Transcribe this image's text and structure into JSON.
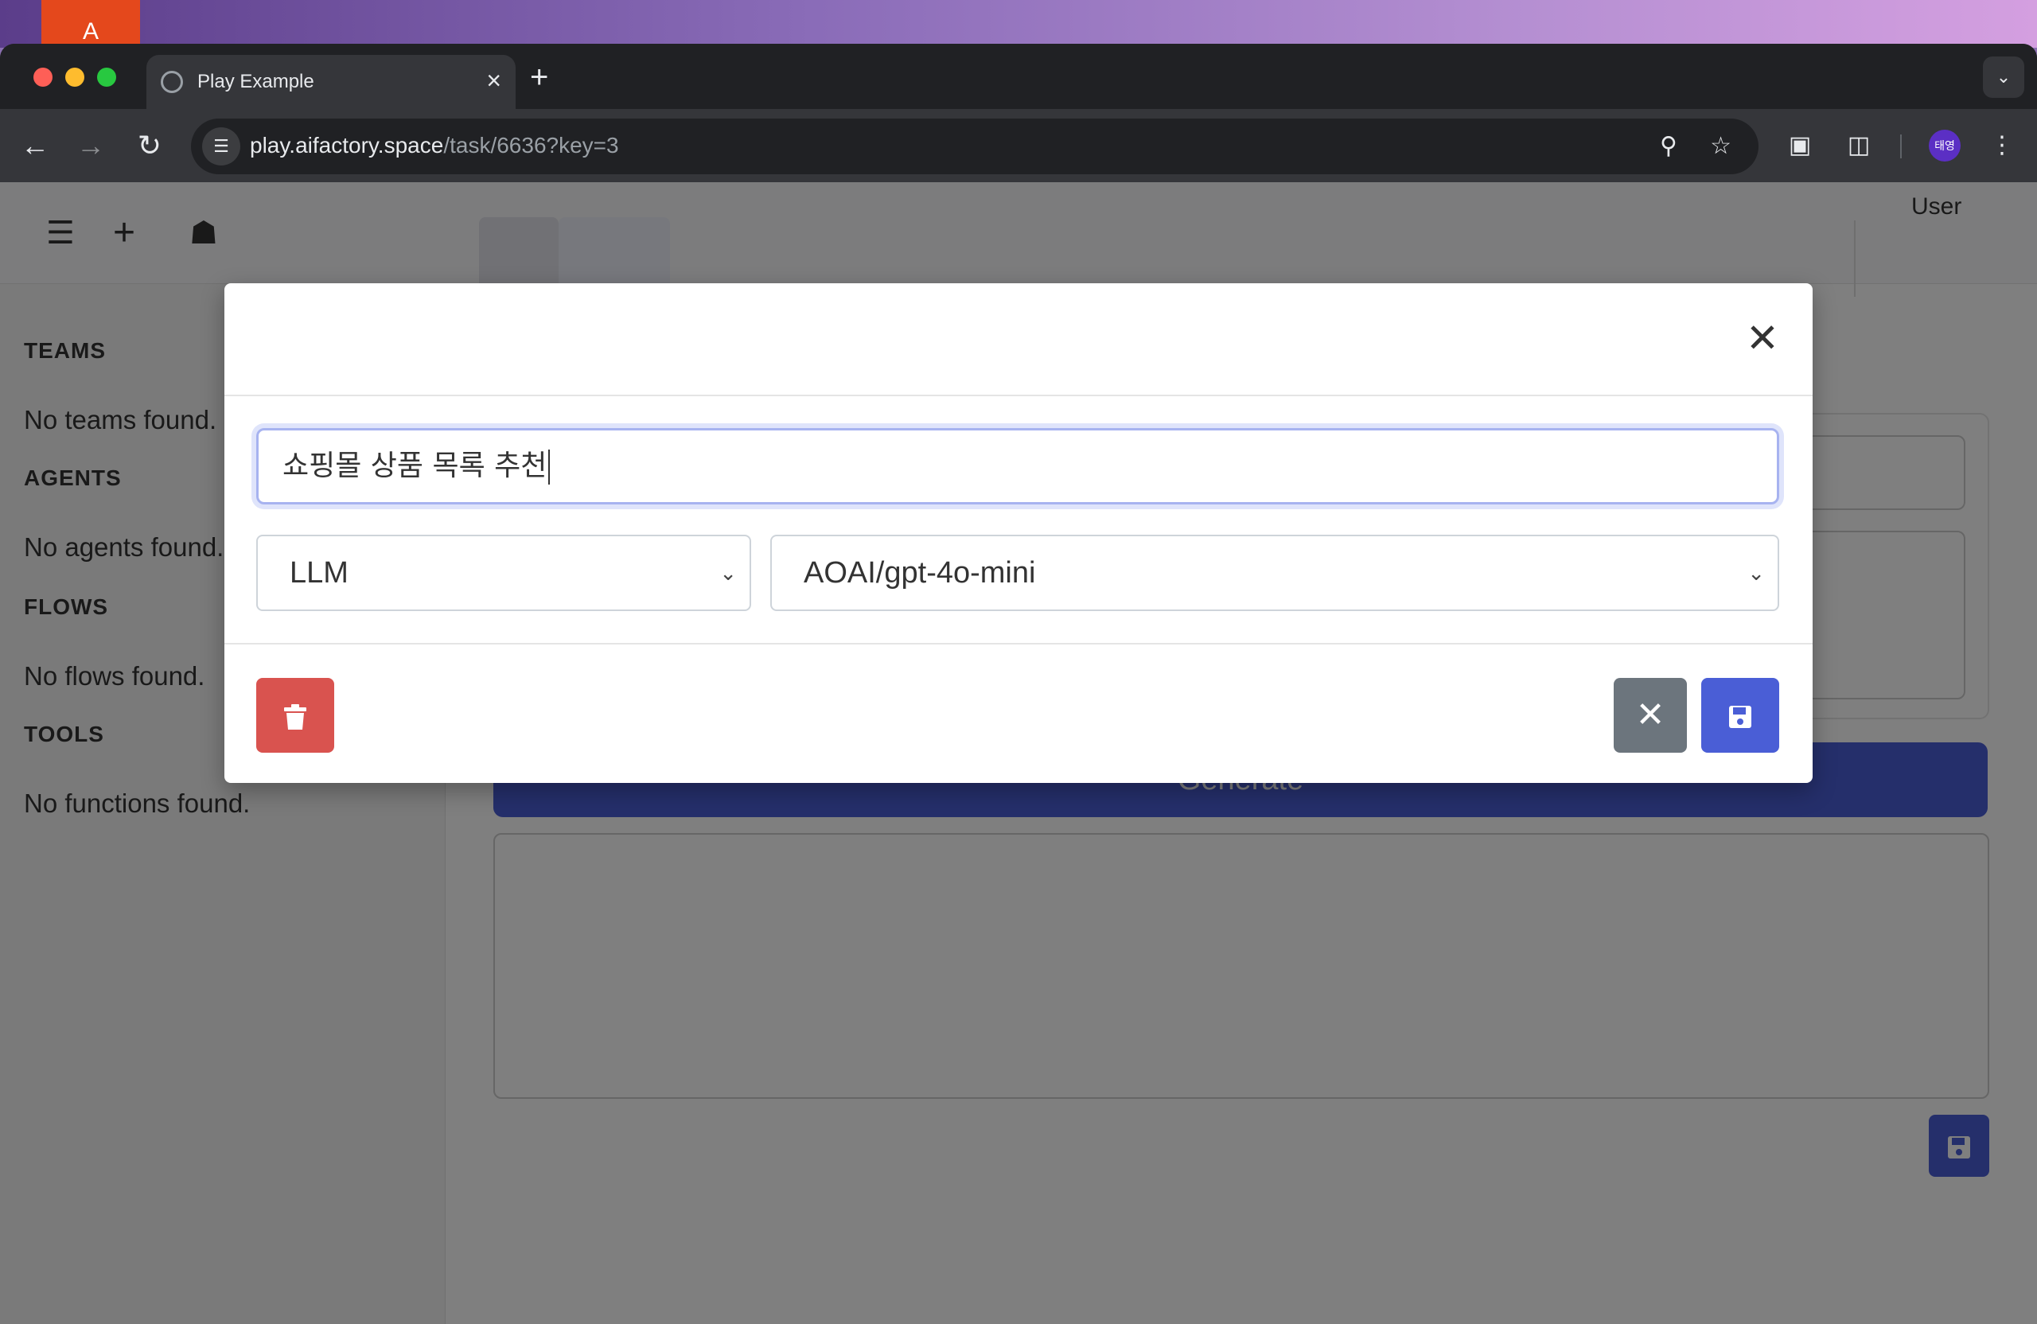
{
  "desktop": {
    "dock_glyph": "A",
    "accent": "#e4481c"
  },
  "browser": {
    "tab_title": "Play Example",
    "tab_close_glyph": "×",
    "new_tab_glyph": "+",
    "url_host": "play.aifactory.space",
    "url_path": "/task/6636?key=3",
    "profile_initials": "태영"
  },
  "app": {
    "header": {
      "user_label": "User"
    },
    "sidebar": {
      "sections": [
        {
          "heading": "TEAMS",
          "empty_text": "No teams found."
        },
        {
          "heading": "AGENTS",
          "empty_text": "No agents found."
        },
        {
          "heading": "FLOWS",
          "empty_text": "No flows found."
        },
        {
          "heading": "TOOLS",
          "empty_text": "No functions found."
        }
      ]
    },
    "generate_label": "Generate"
  },
  "modal": {
    "name_value": "쇼핑몰 상품 목록 추천",
    "type_selected": "LLM",
    "model_selected": "AOAI/gpt-4o-mini",
    "colors": {
      "delete": "#d9534f",
      "cancel": "#6c757d",
      "save": "#4a5ed6",
      "focus_ring": "#a7b3f0"
    }
  }
}
